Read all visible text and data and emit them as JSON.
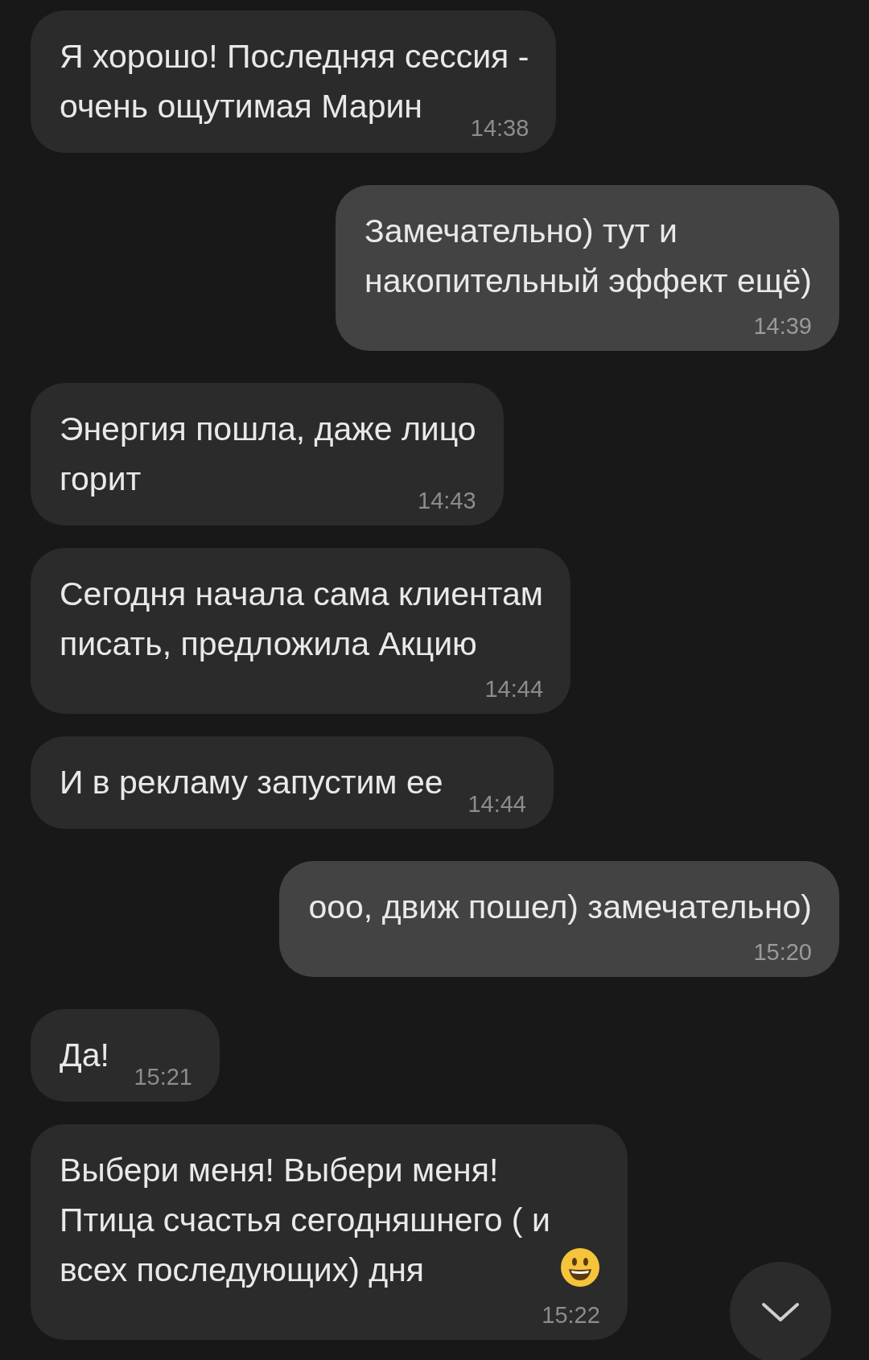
{
  "messages": [
    {
      "kind": "incoming",
      "text": "Я хорошо! Последняя сессия -\nочень ощутимая Марин",
      "time": "14:38"
    },
    {
      "kind": "outgoing",
      "text": "Замечательно) тут и\nнакопительный эффект ещё)",
      "time": "14:39"
    },
    {
      "kind": "incoming",
      "text": "Энергия пошла, даже лицо\nгорит",
      "time": "14:43"
    },
    {
      "kind": "incoming",
      "text": "Сегодня начала сама клиентам\nписать, предложила Акцию",
      "time": "14:44"
    },
    {
      "kind": "incoming",
      "text": "И в рекламу запустим ее",
      "time": "14:44"
    },
    {
      "kind": "outgoing",
      "text": "ооо, движ пошел) замечательно)",
      "time": "15:20"
    },
    {
      "kind": "incoming",
      "text": "Да!",
      "time": "15:21"
    },
    {
      "kind": "incoming",
      "text": "Выбери меня! Выбери меня!\nПтица счастья сегодняшнего ( и\nвсех последующих) дня",
      "emoji": true,
      "time": "15:22"
    }
  ]
}
